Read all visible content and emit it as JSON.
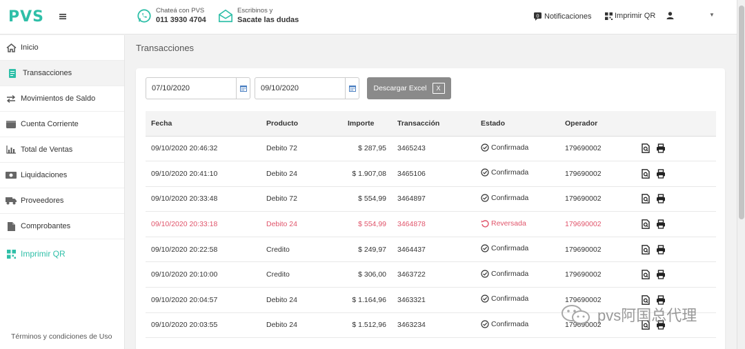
{
  "header": {
    "logo": "PVS",
    "whatsapp": {
      "line1": "Chateá con PVS",
      "line2": "011 3930 4704"
    },
    "email": {
      "line1": "Escribinos y",
      "line2": "Sacate las dudas"
    },
    "notifications_label": "Notificaciones",
    "print_qr_label": "Imprimir QR"
  },
  "sidebar": {
    "items": [
      {
        "label": "Inicio",
        "icon": "home-icon"
      },
      {
        "label": "Transacciones",
        "icon": "receipt-icon"
      },
      {
        "label": "Movimientos de Saldo",
        "icon": "swap-icon"
      },
      {
        "label": "Cuenta Corriente",
        "icon": "wallet-icon"
      },
      {
        "label": "Total de Ventas",
        "icon": "bar-chart-icon"
      },
      {
        "label": "Liquidaciones",
        "icon": "money-icon"
      },
      {
        "label": "Proveedores",
        "icon": "truck-icon"
      },
      {
        "label": "Comprobantes",
        "icon": "file-icon"
      },
      {
        "label": "Imprimir QR",
        "icon": "qr-icon"
      }
    ],
    "footer": "Términos y condiciones de Uso"
  },
  "main": {
    "title": "Transacciones",
    "date_from": "07/10/2020",
    "date_to": "09/10/2020",
    "excel_button": "Descargar Excel",
    "columns": [
      "Fecha",
      "Producto",
      "Importe",
      "Transacción",
      "Estado",
      "Operador"
    ],
    "rows": [
      {
        "fecha": "09/10/2020 20:46:32",
        "producto": "Debito 72",
        "importe": "$ 287,95",
        "transaccion": "3465243",
        "estado": "Confirmada",
        "operador": "179690002",
        "reversed": false
      },
      {
        "fecha": "09/10/2020 20:41:10",
        "producto": "Debito 24",
        "importe": "$ 1.907,08",
        "transaccion": "3465106",
        "estado": "Confirmada",
        "operador": "179690002",
        "reversed": false
      },
      {
        "fecha": "09/10/2020 20:33:48",
        "producto": "Debito 72",
        "importe": "$ 554,99",
        "transaccion": "3464897",
        "estado": "Confirmada",
        "operador": "179690002",
        "reversed": false
      },
      {
        "fecha": "09/10/2020 20:33:18",
        "producto": "Debito 24",
        "importe": "$ 554,99",
        "transaccion": "3464878",
        "estado": "Reversada",
        "operador": "179690002",
        "reversed": true
      },
      {
        "fecha": "09/10/2020 20:22:58",
        "producto": "Credito",
        "importe": "$ 249,97",
        "transaccion": "3464437",
        "estado": "Confirmada",
        "operador": "179690002",
        "reversed": false
      },
      {
        "fecha": "09/10/2020 20:10:00",
        "producto": "Credito",
        "importe": "$ 306,00",
        "transaccion": "3463722",
        "estado": "Confirmada",
        "operador": "179690002",
        "reversed": false
      },
      {
        "fecha": "09/10/2020 20:04:57",
        "producto": "Debito 24",
        "importe": "$ 1.164,96",
        "transaccion": "3463321",
        "estado": "Confirmada",
        "operador": "179690002",
        "reversed": false
      },
      {
        "fecha": "09/10/2020 20:03:55",
        "producto": "Debito 24",
        "importe": "$ 1.512,96",
        "transaccion": "3463234",
        "estado": "Confirmada",
        "operador": "179690002",
        "reversed": false
      }
    ]
  },
  "watermark": "pvs阿国总代理",
  "colors": {
    "brand": "#2fbfa8",
    "reversed": "#e0546a",
    "button": "#8a8a8a"
  }
}
